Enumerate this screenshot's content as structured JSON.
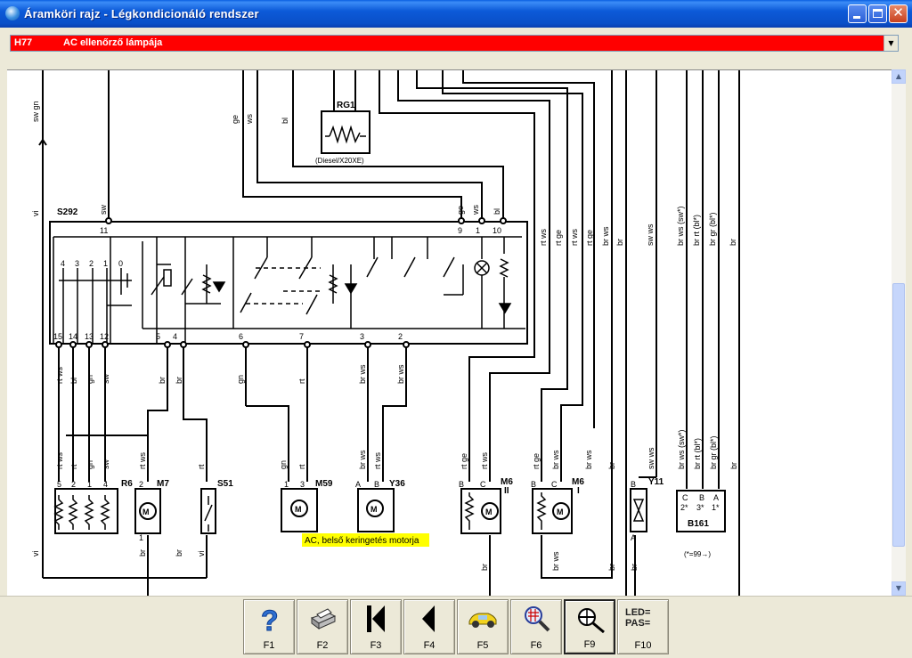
{
  "window": {
    "title": "Áramköri rajz - Légkondicionáló rendszer",
    "icon": "globe-app-icon",
    "buttons": [
      "minimize-icon",
      "maximize-icon",
      "close-icon"
    ]
  },
  "selector": {
    "code": "H77",
    "name": "AC ellenőrző lámpája",
    "background": "#ff0000"
  },
  "diagram": {
    "top_wire_labels": [
      "sw gn",
      "vi",
      "ge",
      "ws",
      "bl"
    ],
    "rg1": {
      "label": "RG1",
      "note": "(Diesel/X20XE)"
    },
    "s292": {
      "label": "S292",
      "top_pins": [
        "11",
        "9",
        "1",
        "10"
      ],
      "bottom_pins": [
        "15",
        "14",
        "13",
        "12",
        "5",
        "4",
        "6",
        "7",
        "3",
        "2"
      ],
      "switch_positions": [
        "4",
        "3",
        "2",
        "1",
        "0"
      ]
    },
    "s292_top_wires": [
      {
        "label": "sw"
      },
      {
        "label": "ge"
      },
      {
        "label": "ws"
      },
      {
        "label": "bl"
      }
    ],
    "right_wires_upper": [
      "rt ws",
      "rt ge",
      "rt ws",
      "rt ge",
      "br ws",
      "br",
      "sw ws",
      "br ws (sw*)",
      "br rt (bl*)",
      "br gr (bl*)",
      "br"
    ],
    "mid_wires": [
      "rt ws",
      "bl",
      "gn",
      "sw",
      "br",
      "br",
      "gn",
      "rt",
      "br ws",
      "br ws"
    ],
    "lower_wires": [
      "rt ws",
      "rt",
      "gn",
      "sw",
      "rt ws",
      "rt",
      "gn",
      "rt",
      "br ws",
      "rt ws",
      "rt ge",
      "rt ws",
      "rt ge",
      "br ws",
      "br",
      "sw ws",
      "br ws (sw*)",
      "br rt (bl*)",
      "br gr (bl*)",
      "br"
    ],
    "components": {
      "r6": {
        "label": "R6",
        "pins": [
          "5",
          "2",
          "1",
          "4"
        ]
      },
      "m7": {
        "label": "M7",
        "pins": [
          "2",
          "1"
        ]
      },
      "s51": {
        "label": "S51"
      },
      "m59": {
        "label": "M59",
        "pins": [
          "1",
          "3"
        ]
      },
      "y36": {
        "label": "Y36",
        "pins": [
          "A",
          "B"
        ]
      },
      "m6_ii": {
        "label": "M6",
        "sub": "II",
        "pins": [
          "B",
          "C"
        ]
      },
      "m6_i": {
        "label": "M6",
        "sub": "I",
        "pins": [
          "B",
          "C"
        ]
      },
      "y11": {
        "label": "Y11",
        "pins": [
          "B",
          "A"
        ]
      },
      "b161": {
        "label": "B161",
        "pins": [
          "C",
          "B",
          "A"
        ],
        "pins2": [
          "2*",
          "3*",
          "1*"
        ],
        "note": "(*=99→)"
      }
    },
    "bottom_wire_labels": [
      "vi",
      "br",
      "br",
      "vi",
      "br",
      "br ws",
      "br",
      "br",
      "br"
    ],
    "tooltip": "AC, belső keringetés motorja"
  },
  "toolbar": {
    "buttons": [
      {
        "key": "F1",
        "icon": "help-question-icon"
      },
      {
        "key": "F2",
        "icon": "printer-icon"
      },
      {
        "key": "F3",
        "icon": "skip-to-first-icon"
      },
      {
        "key": "F4",
        "icon": "previous-icon"
      },
      {
        "key": "F5",
        "icon": "car-icon"
      },
      {
        "key": "F6",
        "icon": "diagram-zoom-icon"
      },
      {
        "key": "F9",
        "icon": "connector-search-icon",
        "active": true
      },
      {
        "key": "F10",
        "icon": "led-pass-icon",
        "icon_text": [
          "LED=",
          "PAS="
        ]
      }
    ]
  }
}
